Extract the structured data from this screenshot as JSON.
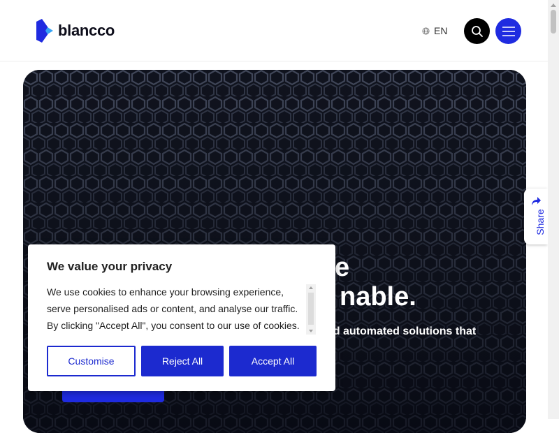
{
  "header": {
    "logo_text": "blancco",
    "language": "EN"
  },
  "hero": {
    "title_line1": "e",
    "title_line2": "nable.",
    "subtitle": "nd automated solutions that"
  },
  "share": {
    "label": "Share"
  },
  "cookie_banner": {
    "title": "We value your privacy",
    "body": "We use cookies to enhance your browsing experience, serve personalised ads or content, and analyse our traffic. By clicking \"Accept All\", you consent to our use of cookies.",
    "customise_label": "Customise",
    "reject_label": "Reject All",
    "accept_label": "Accept All"
  },
  "colors": {
    "brand_blue": "#1f2be0",
    "cookie_button_blue": "#1c2acf",
    "hero_background": "#0a0d16"
  }
}
